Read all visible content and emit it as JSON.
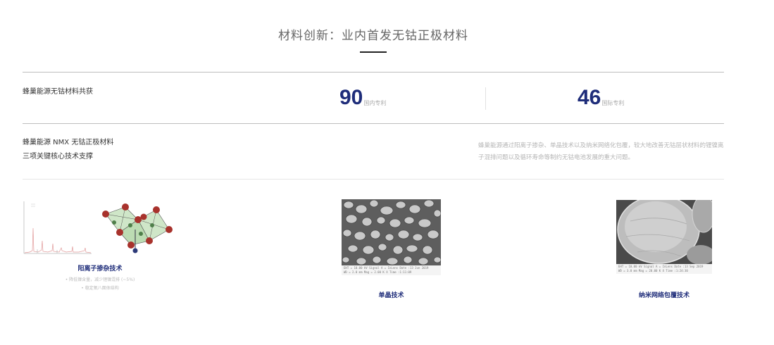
{
  "header": {
    "title": "材料创新：业内首发无钴正极材料"
  },
  "patents": {
    "label": "蜂巢能源无钴材料共获",
    "domestic": {
      "value": "90",
      "unit": "国内专利"
    },
    "international": {
      "value": "46",
      "unit": "国际专利"
    }
  },
  "core": {
    "line1": "蜂巢能源 NMX 无钴正极材料",
    "line2": "三项关键核心技术支撑",
    "description": "蜂巢能源通过阳离子掺杂、单晶技术以及纳米网络化包覆，较大地改善无钴层状材料的锂镍离子混排问题以及循环寿命等制约无钴电池发展的重大问题。"
  },
  "techs": [
    {
      "caption": "阳离子掺杂技术",
      "notes": [
        "• 降低镍含量，减少锂镍混排 (~5%)",
        "• 稳定氧八面体结构"
      ]
    },
    {
      "caption": "单晶技术"
    },
    {
      "caption": "纳米网络包覆技术"
    }
  ],
  "micrographs": {
    "single": [
      "EHT = 10.00 kV   Signal A = InLens   Date :13 Jun 2019",
      "WD = 2.0 mm   Mag = 2.00 K X   Time :1:11:09"
    ],
    "nano": [
      "EHT = 10.00 kV   Signal A = InLens   Date :13 Sep 2019",
      "WD = 3.0 mm   Mag = 20.00 K X   Time :1:24:30"
    ]
  },
  "colors": {
    "accent": "#1f2d7a",
    "divider": "#bdbdbd",
    "muted": "#b5b5b5"
  }
}
